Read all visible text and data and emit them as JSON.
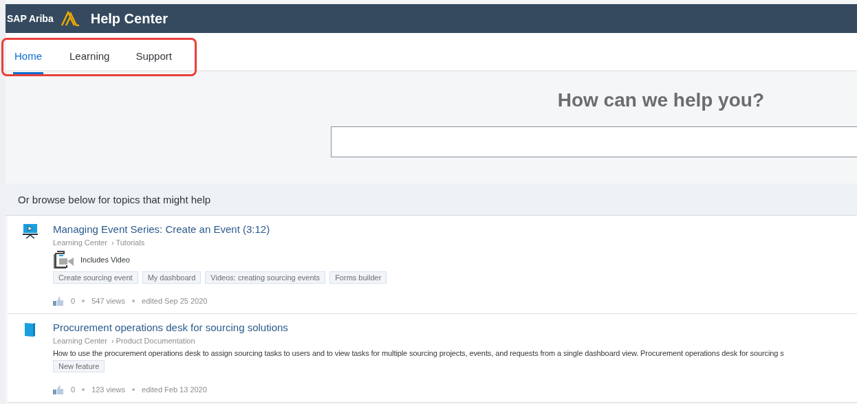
{
  "header": {
    "brand": "SAP Ariba",
    "title": "Help Center"
  },
  "tabs": [
    {
      "label": "Home",
      "selected": true
    },
    {
      "label": "Learning",
      "selected": false
    },
    {
      "label": "Support",
      "selected": false
    }
  ],
  "hero": {
    "heading": "How can we help you?"
  },
  "browse": {
    "heading": "Or browse below for topics that might help"
  },
  "results": [
    {
      "kind": "video",
      "title": "Managing Event Series: Create an Event (3:12)",
      "path": [
        "Learning Center",
        "› Tutorials"
      ],
      "includes": "Includes Video",
      "tags": [
        "Create sourcing event",
        "My dashboard",
        "Videos: creating sourcing events",
        "Forms builder"
      ],
      "likes": "0",
      "views": "547 views",
      "edited": "edited Sep 25 2020"
    },
    {
      "kind": "document",
      "title": "Procurement operations desk for sourcing solutions",
      "path": [
        "Learning Center",
        "› Product Documentation"
      ],
      "description": "How to use the procurement operations desk to assign sourcing tasks to users and to view tasks for multiple sourcing projects, events, and requests from a single dashboard view. Procurement operations desk for sourcing s",
      "tags": [
        "New feature"
      ],
      "likes": "0",
      "views": "123 views",
      "edited": "edited Feb 13 2020"
    }
  ]
}
